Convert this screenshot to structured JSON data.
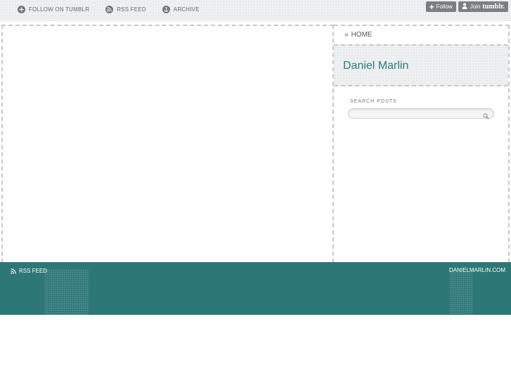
{
  "topnav": {
    "items": [
      {
        "label": "FOLLOW ON TUMBLR",
        "icon": "plus-circle-icon"
      },
      {
        "label": "RSS FEED",
        "icon": "rss-icon"
      },
      {
        "label": "ARCHIVE",
        "icon": "anchor-icon"
      }
    ]
  },
  "tumblr_bar": {
    "follow_label": "Follow",
    "join_label": "Join",
    "join_brand": "tumblr."
  },
  "sidebar": {
    "home_label": "HOME",
    "site_title": "Daniel Marlin",
    "search_label": "SEARCH POSTS",
    "search_value": ""
  },
  "footer": {
    "rss_label": "RSS FEED",
    "site_label": "DANIELMARLIN.COM"
  },
  "colors": {
    "accent": "#2e7a7a",
    "footer_bg": "#2e7777",
    "topbar_bg": "#eef0f2"
  }
}
